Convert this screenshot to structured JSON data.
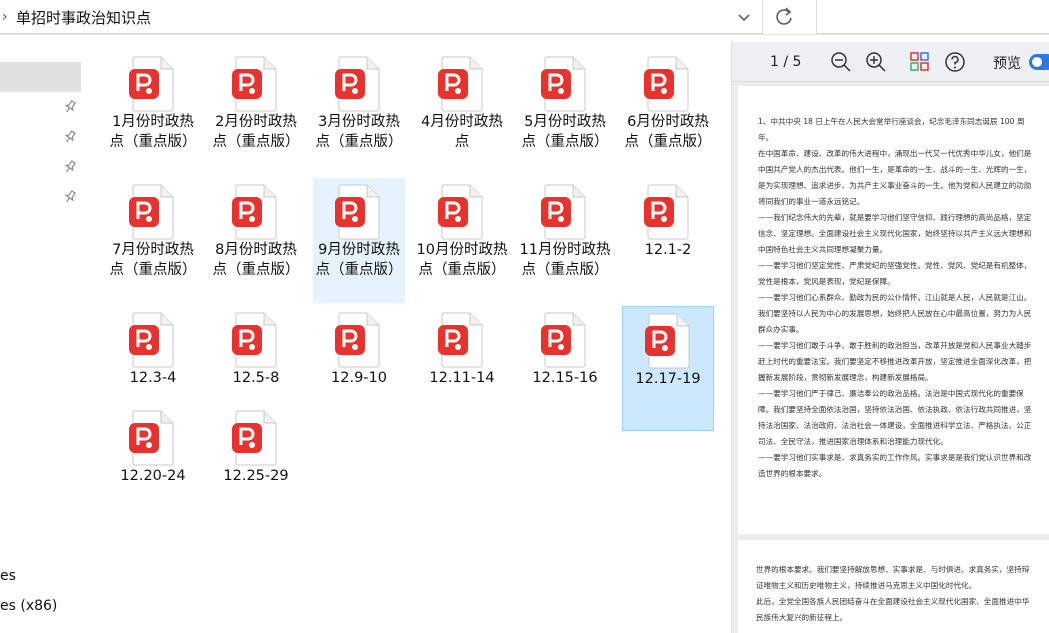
{
  "address_bar": {
    "path": "单招时事政治知识点"
  },
  "nav": {
    "items": [
      {
        "label": "es"
      },
      {
        "label": "es (x86)"
      }
    ]
  },
  "files": [
    {
      "name": "1月份时政热点（重点版）"
    },
    {
      "name": "2月份时政热点（重点版）"
    },
    {
      "name": "3月份时政热点（重点版）"
    },
    {
      "name": "4月份时政热点"
    },
    {
      "name": "5月份时政热点（重点版）"
    },
    {
      "name": "6月份时政热点（重点版）"
    },
    {
      "name": "7月份时政热点（重点版）"
    },
    {
      "name": "8月份时政热点（重点版）"
    },
    {
      "name": "9月份时政热点（重点版）"
    },
    {
      "name": "10月份时政热点（重点版）"
    },
    {
      "name": "11月份时政热点（重点版）"
    },
    {
      "name": "12.1-2"
    },
    {
      "name": "12.3-4"
    },
    {
      "name": "12.5-8"
    },
    {
      "name": "12.9-10"
    },
    {
      "name": "12.11-14"
    },
    {
      "name": "12.15-16"
    },
    {
      "name": "12.17-19"
    },
    {
      "name": "12.20-24"
    },
    {
      "name": "12.25-29"
    }
  ],
  "preview": {
    "page_indicator": "1 / 5",
    "preview_label": "预览",
    "toggle_on": true,
    "doc_paragraphs": [
      "1、中共中央 18 日上午在人民大会堂举行座谈会，纪念毛泽东同志诞辰 100 周年。",
      "在中国革命、建设、改革的伟大进程中，涌现出一代又一代优秀中华儿女，他们是中国共产党人的杰出代表。他们一生，是革命的一生、战斗的一生、光辉的一生，是为实现理想、追求进步、为共产主义事业奋斗的一生。他为党和人民建立的功勋将同我们的事业一道永远铭记。",
      "——我们纪念伟大的先辈，就是要学习他们坚守信仰、践行理想的高尚品格，坚定信念、坚定理想。全面建设社会主义现代化国家，始终坚持以共产主义远大理想和中国特色社会主义共同理想凝聚力量。",
      "——要学习他们坚定党性、严肃党纪的坚强党性。党性、党风、党纪是有机整体，党性是根本，党风是表现，党纪是保障。",
      "——要学习他们心系群众、勤政为民的公仆情怀。江山就是人民，人民就是江山。我们要坚持以人民为中心的发展思想，始终把人民放在心中最高位置，努力为人民群众办实事。",
      "——要学习他们敢于斗争、敢于胜利的政治担当，改革开放是党和人民事业大踏步赶上时代的重要法宝。我们要坚定不移推进改革开放，坚定推进全面深化改革，把握新发展阶段，贯彻新发展理念，构建新发展格局。",
      "——要学习他们严于律己、廉洁奉公的政治品格。法治是中国式现代化的重要保障。我们要坚持全面依法治国，坚持依法治国、依法执政、依法行政共同推进，坚持法治国家、法治政府、法治社会一体建设，全面推进科学立法、严格执法、公正司法、全民守法，推进国家治理体系和治理能力现代化。",
      "——要学习他们实事求是、求真务实的工作作风。实事求是是我们党认识世界和改造世界的根本要求。"
    ],
    "doc2_paragraphs": [
      "世界的根本要求。我们要坚持解放思想、实事求是、与时俱进、求真务实，坚持辩证唯物主义和历史唯物主义，持续推进马克思主义中国化时代化。",
      "此后，全党全国各族人民团结奋斗在全面建设社会主义现代化国家、全面推进中华民族伟大复兴的新征程上。"
    ]
  },
  "colors": {
    "selected_bg": "#cce8ff",
    "hover_bg": "#e5f3ff",
    "pdf_red": "#e8322e",
    "accent": "#2b79e4"
  },
  "icons": [
    "chevron-down-icon",
    "refresh-icon",
    "pin-icon",
    "pdf-file-icon",
    "zoom-out-icon",
    "zoom-in-icon",
    "thumbnails-icon",
    "help-icon"
  ]
}
